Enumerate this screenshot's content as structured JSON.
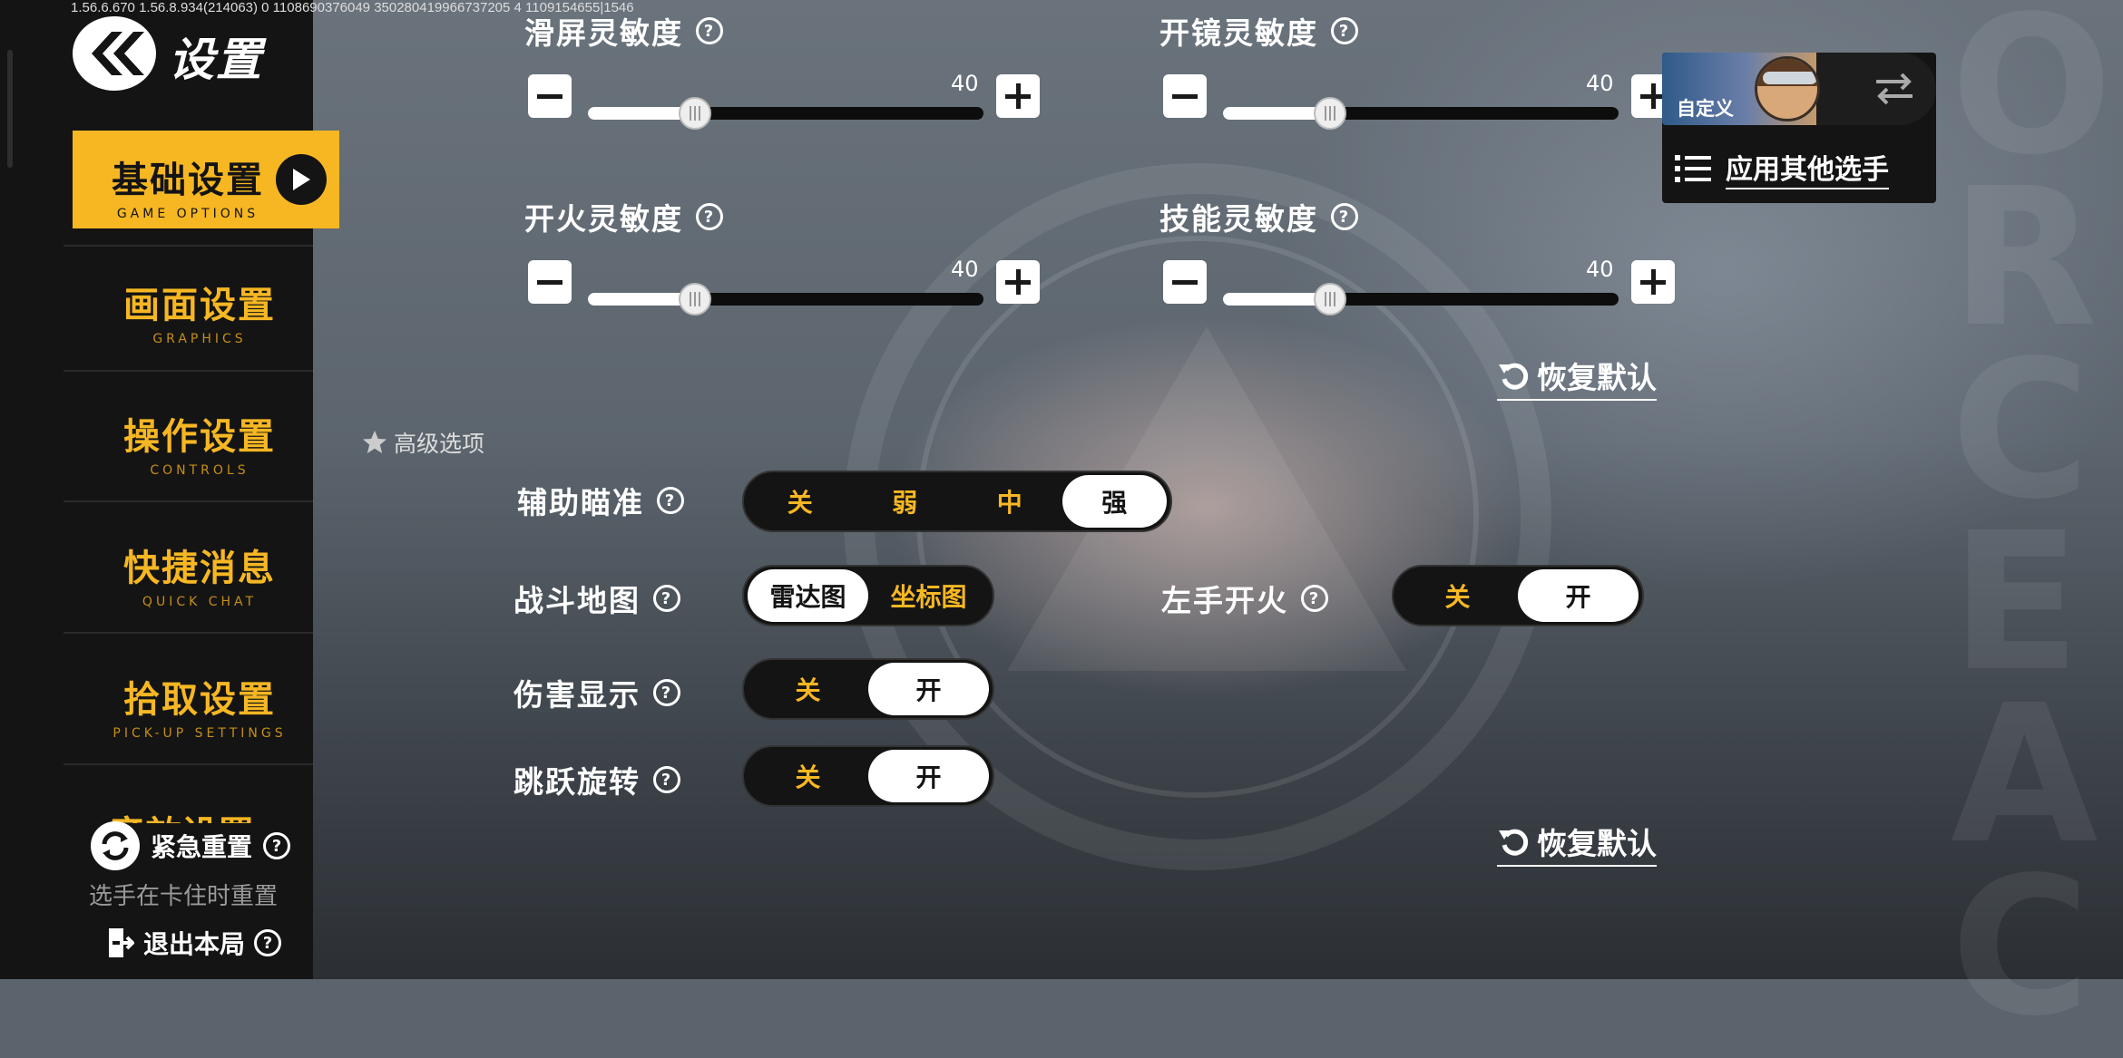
{
  "version_text": "1.56.6.670  1.56.8.934(214063)  0  1108690376049  350280419966737205 4 1109154655|1546",
  "header": {
    "title": "设置"
  },
  "sidebar": {
    "items": [
      {
        "cn": "基础设置",
        "en": "GAME OPTIONS",
        "active": true
      },
      {
        "cn": "画面设置",
        "en": "GRAPHICS",
        "active": false
      },
      {
        "cn": "操作设置",
        "en": "CONTROLS",
        "active": false
      },
      {
        "cn": "快捷消息",
        "en": "QUICK CHAT",
        "active": false
      },
      {
        "cn": "拾取设置",
        "en": "PICK-UP SETTINGS",
        "active": false
      }
    ],
    "partial_item": "音效设置",
    "emergency_reset": "紧急重置",
    "emergency_reset_sub": "选手在卡住时重置",
    "exit_game": "退出本局"
  },
  "sensitivity": {
    "screen_swipe": {
      "label": "滑屏灵敏度",
      "value": 40,
      "percent": 0.27
    },
    "scope": {
      "label": "开镜灵敏度",
      "value": 40,
      "percent": 0.27
    },
    "fire": {
      "label": "开火灵敏度",
      "value": 40,
      "percent": 0.27
    },
    "skill": {
      "label": "技能灵敏度",
      "value": 40,
      "percent": 0.27
    },
    "restore_label": "恢复默认"
  },
  "advanced": {
    "title": "高级选项",
    "aim_assist": {
      "label": "辅助瞄准",
      "options": [
        "关",
        "弱",
        "中",
        "强"
      ],
      "selected": "强"
    },
    "battle_map": {
      "label": "战斗地图",
      "options": [
        "雷达图",
        "坐标图"
      ],
      "selected": "雷达图"
    },
    "left_fire": {
      "label": "左手开火",
      "options": [
        "关",
        "开"
      ],
      "selected": "开"
    },
    "damage_display": {
      "label": "伤害显示",
      "options": [
        "关",
        "开"
      ],
      "selected": "开"
    },
    "jump_rotate": {
      "label": "跳跃旋转",
      "options": [
        "关",
        "开"
      ],
      "selected": "开"
    },
    "restore_label": "恢复默认"
  },
  "profile": {
    "name": "自定义",
    "apply_label": "应用其他选手"
  },
  "colors": {
    "accent": "#f6b723",
    "sidebar_bg": "#141414",
    "selected_option": "#ffffff"
  },
  "watermark": "ORCEAC"
}
